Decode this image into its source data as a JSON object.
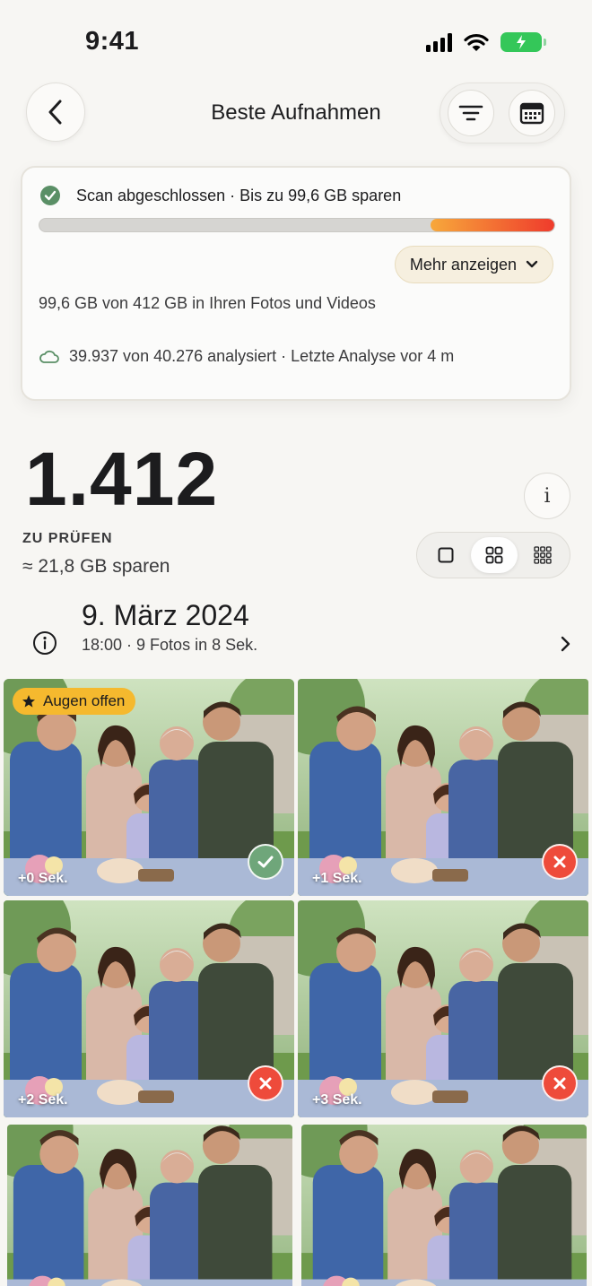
{
  "status_bar": {
    "time": "9:41"
  },
  "nav": {
    "title": "Beste Aufnahmen",
    "back_icon": "chevron-left-icon",
    "filter_icon": "filter-lines-icon",
    "calendar_icon": "calendar-icon"
  },
  "scan": {
    "status_text": "Scan abgeschlossen · Bis zu 99,6 GB sparen",
    "progress_fraction": 0.24,
    "more_label": "Mehr anzeigen",
    "storage_text": "99,6 GB von 412 GB in Ihren Fotos und Videos",
    "analysis_text": "39.937 von 40.276 analysiert · Letzte Analyse vor 4 m"
  },
  "summary": {
    "count": "1.412",
    "review_label": "ZU PRÜFEN",
    "savings_label": "≈ 21,8 GB sparen",
    "info_symbol": "i"
  },
  "group": {
    "date": "9. März 2024",
    "subtitle": "18:00 · 9 Fotos in 8 Sek."
  },
  "photos": [
    {
      "badge": "Augen offen",
      "time": "+0 Sek.",
      "status": "keep"
    },
    {
      "badge": "",
      "time": "+1 Sek.",
      "status": "drop"
    },
    {
      "badge": "",
      "time": "+2 Sek.",
      "status": "drop"
    },
    {
      "badge": "",
      "time": "+3 Sek.",
      "status": "drop"
    },
    {
      "badge": "",
      "time": "",
      "status": ""
    },
    {
      "badge": "",
      "time": "",
      "status": ""
    }
  ],
  "colors": {
    "accent_green": "#5f9668",
    "keep_green": "#6fa67a",
    "drop_red": "#ee4b3b",
    "badge_yellow": "#f5b92e",
    "battery_green": "#34c759"
  }
}
